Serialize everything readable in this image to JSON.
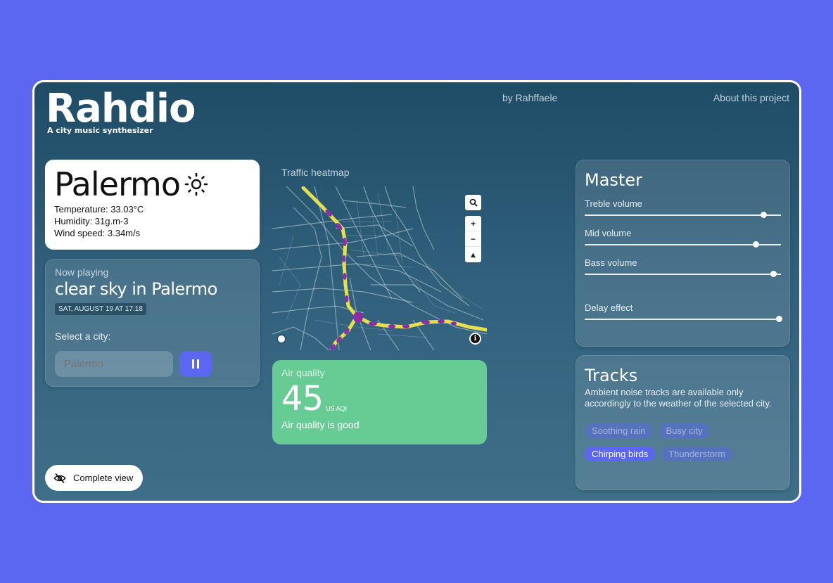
{
  "app": {
    "title": "Rahdio",
    "tagline": "A city music synthesizer",
    "author_link": "by Rahffaele",
    "about_link": "About this project"
  },
  "weather": {
    "city": "Palermo",
    "icon": "sun-icon",
    "temperature": "Temperature: 33.03°C",
    "humidity": "Humidity: 31g.m-3",
    "wind": "Wind speed: 3.34m/s"
  },
  "now_playing": {
    "label": "Now playing",
    "title": "clear sky in Palermo",
    "datetime": "SAT, AUGUST 19 AT 17:18",
    "select_label": "Select a city:",
    "city_input_placeholder": "Palermo",
    "pause_icon": "pause-icon"
  },
  "map": {
    "title": "Traffic heatmap",
    "controls": {
      "search": "search-icon",
      "zoom_in": "+",
      "zoom_out": "−",
      "compass": "▴"
    },
    "info": "i"
  },
  "air_quality": {
    "label": "Air quality",
    "value": "45",
    "unit": "US AQI",
    "description": "Air quality is good",
    "color": "#66cc94"
  },
  "master": {
    "title": "Master",
    "sliders": [
      {
        "label": "Treble volume",
        "value": 0.91
      },
      {
        "label": "Mid volume",
        "value": 0.87
      },
      {
        "label": "Bass volume",
        "value": 0.96
      },
      {
        "label": "Delay effect",
        "value": 0.99
      }
    ]
  },
  "tracks": {
    "title": "Tracks",
    "description": "Ambient noise tracks are available only accordingly to the weather of the selected city.",
    "items": [
      {
        "label": "Soothing rain",
        "active": false
      },
      {
        "label": "Busy city",
        "active": false
      },
      {
        "label": "Chirping birds",
        "active": true
      },
      {
        "label": "Thunderstorm",
        "active": false
      }
    ]
  },
  "complete_view": {
    "label": "Complete view",
    "icon": "eye-off-icon"
  },
  "colors": {
    "page_background": "#5b67f0",
    "accent": "#5b67f0",
    "panel": "#1f4c66",
    "heat_yellow": "#e8e04a",
    "heat_purple": "#8a2fa8"
  }
}
